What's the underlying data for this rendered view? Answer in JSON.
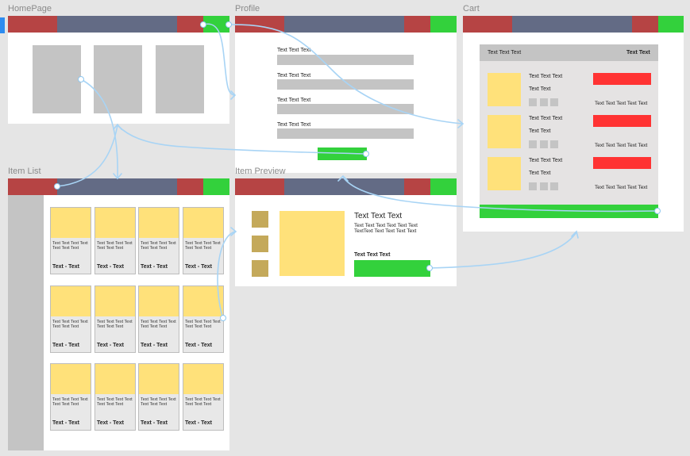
{
  "frames": {
    "homepage": {
      "label": "HomePage"
    },
    "profile": {
      "label": "Profile",
      "field_labels": [
        "Text Text Text",
        "Text Text Text",
        "Text Text Text",
        "Text Text Text"
      ]
    },
    "cart": {
      "label": "Cart",
      "header_left": "Text Text Text",
      "header_right": "Text Text",
      "items": [
        {
          "title": "Text Text Text",
          "subtitle": "Text Text",
          "right_text": "Text Text Text Text Text"
        },
        {
          "title": "Text Text Text",
          "subtitle": "Text Text",
          "right_text": "Text Text Text Text Text"
        },
        {
          "title": "Text Text Text",
          "subtitle": "Text Text",
          "right_text": "Text Text Text Text Text"
        }
      ]
    },
    "item_list": {
      "label": "Item List",
      "card_text": "Text Text Text Text Text Text Text",
      "card_title": "Text - Text"
    },
    "item_preview": {
      "label": "Item Preview",
      "title": "Text Text Text",
      "description": "Text Text Text Text Text Text TextText Text Text Text Text",
      "price_label": "Text Text Text"
    }
  },
  "colors": {
    "canvas": "#e5e5e5",
    "nav_red": "#b64444",
    "nav_slate": "#636b85",
    "nav_green": "#33d13c",
    "placeholder_gray": "#c4c4c4",
    "image_yellow": "#ffe17a",
    "alert_red": "#ff3333",
    "link_blue": "#8ec7ef"
  }
}
